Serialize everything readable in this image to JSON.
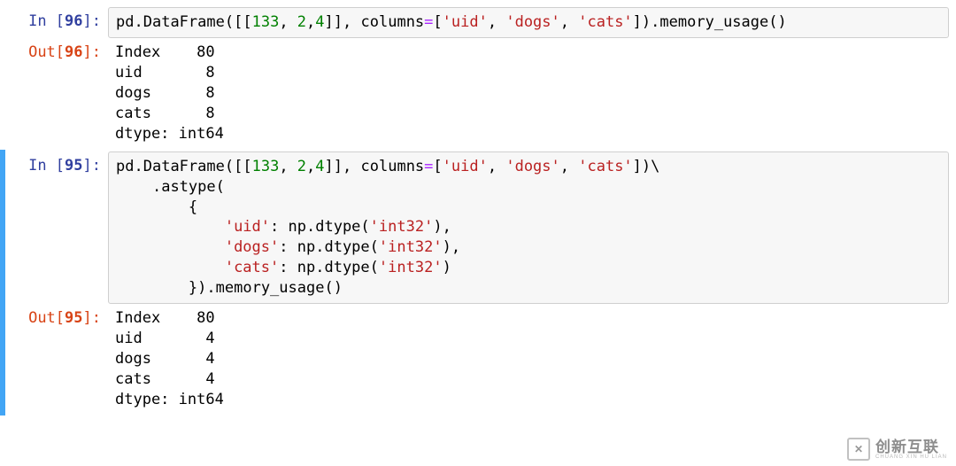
{
  "cells": [
    {
      "in_label": "In [",
      "in_num": "96",
      "in_label_end": "]:",
      "out_label": "Out[",
      "out_num": "96",
      "out_label_end": "]:",
      "code_tokens": {
        "pd": "pd",
        "dot1": ".",
        "DataFrame": "DataFrame",
        "lp1": "(",
        "lb1": "[[",
        "n133": "133",
        "c1": ", ",
        "n2": "2",
        "c2": ",",
        "n4": "4",
        "rb1": "]]",
        "c3": ", ",
        "columns": "columns",
        "eq": "=",
        "lb2": "[",
        "s_uid": "'uid'",
        "c4": ", ",
        "s_dogs": "'dogs'",
        "c5": ", ",
        "s_cats": "'cats'",
        "rb2": "]",
        "rp1": ")",
        "dot2": ".",
        "mem": "memory_usage",
        "lp2": "(",
        "rp2": ")"
      },
      "output": "Index    80\nuid       8\ndogs      8\ncats      8\ndtype: int64"
    },
    {
      "in_label": "In [",
      "in_num": "95",
      "in_label_end": "]:",
      "out_label": "Out[",
      "out_num": "95",
      "out_label_end": "]:",
      "code_tokens": {
        "l1_pd": "pd",
        "l1_dot": ".",
        "l1_DataFrame": "DataFrame",
        "l1_lp": "(",
        "l1_lb": "[[",
        "l1_n133": "133",
        "l1_c1": ", ",
        "l1_n2": "2",
        "l1_c2": ",",
        "l1_n4": "4",
        "l1_rb": "]]",
        "l1_c3": ", ",
        "l1_columns": "columns",
        "l1_eq": "=",
        "l1_lb2": "[",
        "l1_s_uid": "'uid'",
        "l1_c4": ", ",
        "l1_s_dogs": "'dogs'",
        "l1_c5": ", ",
        "l1_s_cats": "'cats'",
        "l1_rb2": "]",
        "l1_rp": ")",
        "l1_bs": "\\",
        "l2_indent": "    ",
        "l2_dot": ".",
        "l2_astype": "astype",
        "l2_lp": "(",
        "l3_indent": "        ",
        "l3_lbr": "{",
        "l4_indent": "            ",
        "l4_s_uid": "'uid'",
        "l4_colon": ": ",
        "l4_np": "np",
        "l4_dot": ".",
        "l4_dtype": "dtype",
        "l4_lp": "(",
        "l4_s_int32": "'int32'",
        "l4_rp": ")",
        "l4_comma": ",",
        "l5_indent": "            ",
        "l5_s_dogs": "'dogs'",
        "l5_colon": ": ",
        "l5_np": "np",
        "l5_dot": ".",
        "l5_dtype": "dtype",
        "l5_lp": "(",
        "l5_s_int32": "'int32'",
        "l5_rp": ")",
        "l5_comma": ",",
        "l6_indent": "            ",
        "l6_s_cats": "'cats'",
        "l6_colon": ": ",
        "l6_np": "np",
        "l6_dot": ".",
        "l6_dtype": "dtype",
        "l6_lp": "(",
        "l6_s_int32": "'int32'",
        "l6_rp": ")",
        "l7_indent": "        ",
        "l7_rbr": "}",
        "l7_rp": ")",
        "l7_dot": ".",
        "l7_mem": "memory_usage",
        "l7_lp": "(",
        "l7_rp2": ")"
      },
      "output": "Index    80\nuid       4\ndogs      4\ncats      4\ndtype: int64"
    }
  ],
  "watermark": {
    "logo": "✕",
    "main": "创新互联",
    "sub": "CHUANG XIN HU LIAN"
  }
}
